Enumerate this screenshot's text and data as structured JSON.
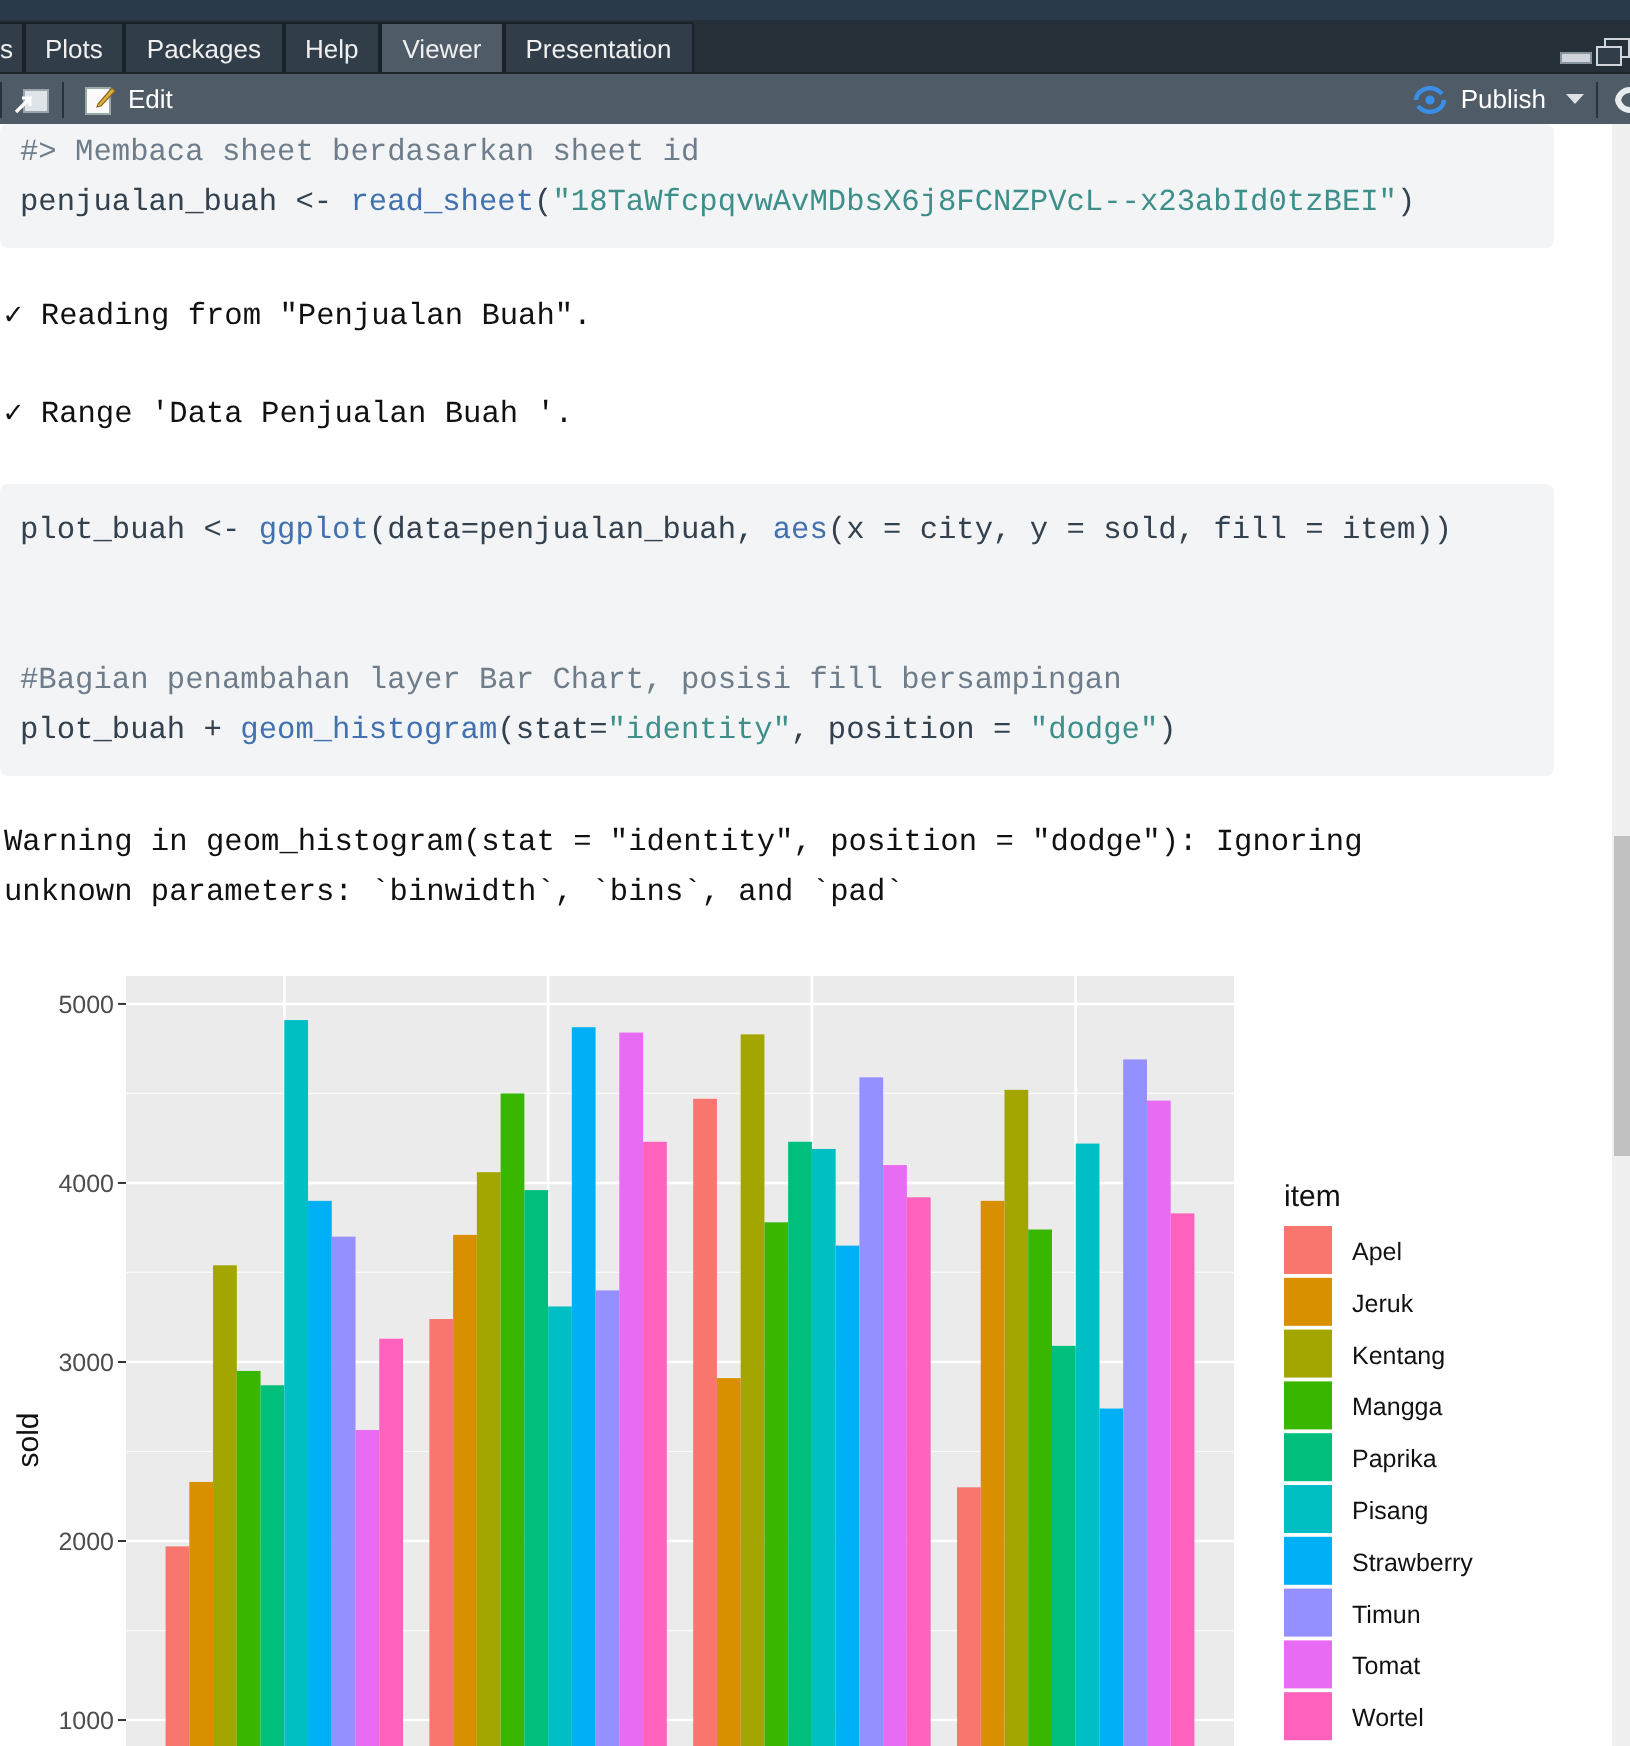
{
  "tabs": [
    {
      "label": "s",
      "selected": false
    },
    {
      "label": "Plots",
      "selected": false
    },
    {
      "label": "Packages",
      "selected": false
    },
    {
      "label": "Help",
      "selected": false
    },
    {
      "label": "Viewer",
      "selected": true
    },
    {
      "label": "Presentation",
      "selected": false
    }
  ],
  "toolbar": {
    "edit_button": "Edit",
    "publish_button": "Publish"
  },
  "document": [
    {
      "kind": "code",
      "paragraphs": [
        [
          [
            {
              "kind": "comment",
              "text": "#> Membaca sheet berdasarkan sheet id"
            }
          ],
          [
            {
              "kind": "plain",
              "text": "penjualan_buah <- "
            },
            {
              "kind": "function",
              "text": "read_sheet"
            },
            {
              "kind": "plain",
              "text": "("
            },
            {
              "kind": "string",
              "text": "\"18TaWfcpqvwAvMDbsX6j8FCNZPVcL--x23abId0tzBEI\""
            },
            {
              "kind": "plain",
              "text": ")"
            }
          ]
        ]
      ]
    },
    {
      "kind": "output",
      "lines": [
        "✓ Reading from \"Penjualan Buah\".",
        "✓ Range 'Data Penjualan Buah '."
      ]
    },
    {
      "kind": "code",
      "paragraphs": [
        [
          [
            {
              "kind": "plain",
              "text": "plot_buah <- "
            },
            {
              "kind": "function",
              "text": "ggplot"
            },
            {
              "kind": "plain",
              "text": "(data=penjualan_buah, "
            },
            {
              "kind": "function",
              "text": "aes"
            },
            {
              "kind": "plain",
              "text": "(x = city, y = sold, fill = item))"
            }
          ]
        ],
        [
          [
            {
              "kind": "comment",
              "text": "#Bagian penambahan layer Bar Chart, posisi fill bersampingan"
            }
          ],
          [
            {
              "kind": "plain",
              "text": "plot_buah + "
            },
            {
              "kind": "function",
              "text": "geom_histogram"
            },
            {
              "kind": "plain",
              "text": "(stat="
            },
            {
              "kind": "string",
              "text": "\"identity\""
            },
            {
              "kind": "plain",
              "text": ", position = "
            },
            {
              "kind": "string",
              "text": "\"dodge\""
            },
            {
              "kind": "plain",
              "text": ")"
            }
          ]
        ]
      ]
    },
    {
      "kind": "warning",
      "lines": [
        "Warning in geom_histogram(stat = \"identity\", position = \"dodge\"): Ignoring",
        "unknown parameters: `binwidth`, `bins`, and `pad`"
      ]
    },
    {
      "kind": "chart",
      "chart_data": {
        "type": "bar",
        "ylabel": "sold",
        "grid": true,
        "legend": {
          "title": "item"
        },
        "ylim": [
          855,
          5156
        ],
        "yticks": [
          1000,
          2000,
          3000,
          4000,
          5000
        ],
        "series": [
          {
            "name": "Apel",
            "color": "#f8766d",
            "values": [
              1970,
              3240,
              4470,
              2300
            ]
          },
          {
            "name": "Jeruk",
            "color": "#d89000",
            "values": [
              2330,
              3710,
              2910,
              3900
            ]
          },
          {
            "name": "Kentang",
            "color": "#a3a500",
            "values": [
              3540,
              4060,
              4830,
              4520
            ]
          },
          {
            "name": "Mangga",
            "color": "#39b600",
            "values": [
              2950,
              4500,
              3780,
              3740
            ]
          },
          {
            "name": "Paprika",
            "color": "#00bf7d",
            "values": [
              2870,
              3960,
              4230,
              3090
            ]
          },
          {
            "name": "Pisang",
            "color": "#00bfc4",
            "values": [
              4910,
              3310,
              4190,
              4220
            ]
          },
          {
            "name": "Strawberry",
            "color": "#00b0f6",
            "values": [
              3900,
              4870,
              3650,
              2740
            ]
          },
          {
            "name": "Timun",
            "color": "#9590ff",
            "values": [
              3700,
              3400,
              4590,
              4690
            ]
          },
          {
            "name": "Tomat",
            "color": "#e76bf3",
            "values": [
              2620,
              4840,
              4100,
              4460
            ]
          },
          {
            "name": "Wortel",
            "color": "#ff62bc",
            "values": [
              3130,
              4230,
              3920,
              3830
            ]
          }
        ]
      }
    }
  ]
}
